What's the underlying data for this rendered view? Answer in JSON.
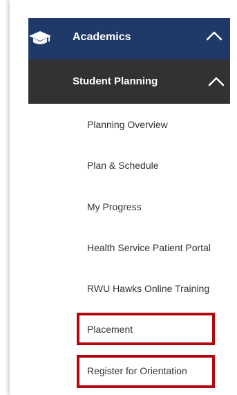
{
  "menu": {
    "academics": {
      "label": "Academics",
      "icon": "graduation-cap-icon",
      "chevron": "chevron-up-icon"
    },
    "student_planning": {
      "label": "Student Planning",
      "chevron": "chevron-up-icon"
    },
    "items": [
      {
        "label": "Planning Overview",
        "highlighted": false
      },
      {
        "label": "Plan & Schedule",
        "highlighted": false
      },
      {
        "label": "My Progress",
        "highlighted": false
      },
      {
        "label": "Health Service Patient Portal",
        "highlighted": false
      },
      {
        "label": "RWU Hawks Online Training",
        "highlighted": false
      },
      {
        "label": "Placement",
        "highlighted": true
      },
      {
        "label": "Register for Orientation",
        "highlighted": true
      }
    ]
  },
  "colors": {
    "academics_bg": "#1f3a68",
    "student_planning_bg": "#323232",
    "highlight_border": "#b1070f",
    "item_text": "#333333"
  }
}
